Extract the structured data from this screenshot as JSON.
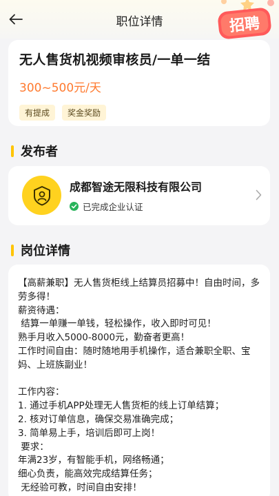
{
  "header": {
    "title": "职位详情",
    "badge_text": "招聘"
  },
  "job": {
    "title": "无人售货机视频审核员/一单一结",
    "salary": "300~500元/天",
    "tags": [
      "有提成",
      "奖金奖励"
    ]
  },
  "publisher_section": {
    "title": "发布者"
  },
  "publisher": {
    "name": "成都智途无限科技有限公司",
    "verification": "已完成企业认证"
  },
  "detail_section": {
    "title": "岗位详情"
  },
  "detail": {
    "text": "【高薪兼职】无人售货柜线上结算员招募中！自由时间，多劳多得！\n薪资待遇：\n 结算一单赚一单钱，轻松操作，收入即时可见！\n熟手月收入5000-8000元，勤奋者更高！\n工作时间自由：随时随地用手机操作，适合兼职全职、宝妈、上班族副业！\n\n工作内容：\n1. 通过手机APP处理无人售货柜的线上订单结算；\n2. 核对订单信息，确保交易准确完成；\n3. 简单易上手，培训后即可上岗！\n 要求：\n年满23岁，有智能手机，网络畅通；\n细心负责，能高效完成结算任务；\n 无经验可教，时间自由安排！"
  },
  "colors": {
    "accent": "#ffc400",
    "salary": "#ff7a2f",
    "verified": "#27b35a",
    "badge": "#ff5a5a"
  }
}
